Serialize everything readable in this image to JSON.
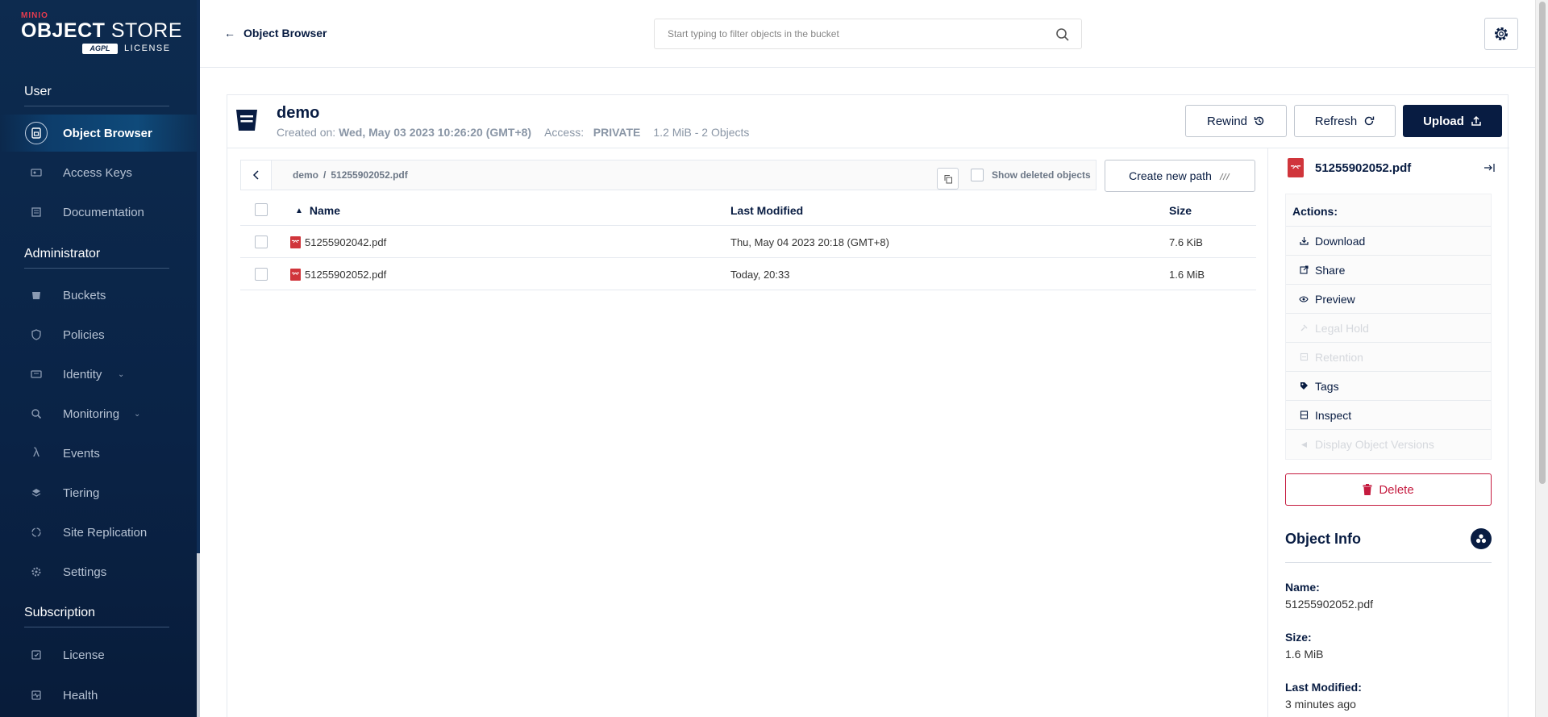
{
  "logo": {
    "brand": "MINIO",
    "product_bold": "OBJECT",
    "product_light": "STORE",
    "badge": "AGPL",
    "license": "LICENSE"
  },
  "sidebar": {
    "sections": [
      {
        "title": "User"
      },
      {
        "title": "Administrator"
      },
      {
        "title": "Subscription"
      }
    ],
    "items": [
      {
        "label": "Object Browser",
        "icon": "object-browser-icon",
        "active": true
      },
      {
        "label": "Access Keys",
        "icon": "access-keys-icon"
      },
      {
        "label": "Documentation",
        "icon": "documentation-icon"
      },
      {
        "label": "Buckets",
        "icon": "buckets-icon"
      },
      {
        "label": "Policies",
        "icon": "policies-icon"
      },
      {
        "label": "Identity",
        "icon": "identity-icon",
        "expandable": true
      },
      {
        "label": "Monitoring",
        "icon": "monitoring-icon",
        "expandable": true
      },
      {
        "label": "Events",
        "icon": "lambda-icon"
      },
      {
        "label": "Tiering",
        "icon": "tiering-icon"
      },
      {
        "label": "Site Replication",
        "icon": "site-replication-icon"
      },
      {
        "label": "Settings",
        "icon": "settings-icon"
      },
      {
        "label": "License",
        "icon": "license-icon"
      },
      {
        "label": "Health",
        "icon": "health-icon"
      }
    ]
  },
  "header": {
    "back_label": "Object Browser",
    "search_placeholder": "Start typing to filter objects in the bucket"
  },
  "bucket": {
    "name": "demo",
    "created_label": "Created on:",
    "created_value": "Wed, May 03 2023 10:26:20 (GMT+8)",
    "access_label": "Access:",
    "access_value": "PRIVATE",
    "summary": "1.2 MiB - 2 Objects"
  },
  "buttons": {
    "rewind": "Rewind",
    "refresh": "Refresh",
    "upload": "Upload",
    "create_path": "Create new path"
  },
  "path": {
    "bucket": "demo",
    "separator": "/",
    "object": "51255902052.pdf",
    "show_deleted": "Show deleted objects"
  },
  "table": {
    "columns": [
      "Name",
      "Last Modified",
      "Size"
    ],
    "rows": [
      {
        "name": "51255902042.pdf",
        "modified": "Thu, May 04 2023 20:18 (GMT+8)",
        "size": "7.6 KiB"
      },
      {
        "name": "51255902052.pdf",
        "modified": "Today, 20:33",
        "size": "1.6 MiB"
      }
    ]
  },
  "detail": {
    "file_name": "51255902052.pdf",
    "actions_title": "Actions:",
    "actions": [
      {
        "label": "Download",
        "enabled": true
      },
      {
        "label": "Share",
        "enabled": true
      },
      {
        "label": "Preview",
        "enabled": true
      },
      {
        "label": "Legal Hold",
        "enabled": false
      },
      {
        "label": "Retention",
        "enabled": false
      },
      {
        "label": "Tags",
        "enabled": true
      },
      {
        "label": "Inspect",
        "enabled": true
      },
      {
        "label": "Display Object Versions",
        "enabled": false
      }
    ],
    "delete_label": "Delete",
    "info_title": "Object Info",
    "info": [
      {
        "label": "Name:",
        "value": "51255902052.pdf"
      },
      {
        "label": "Size:",
        "value": "1.6 MiB"
      },
      {
        "label": "Last Modified:",
        "value": "3 minutes ago"
      }
    ]
  },
  "colors": {
    "sidebar_bg": "#0a2346",
    "primary": "#081c42",
    "danger": "#c51b3f",
    "pdf_red": "#d0353b"
  }
}
